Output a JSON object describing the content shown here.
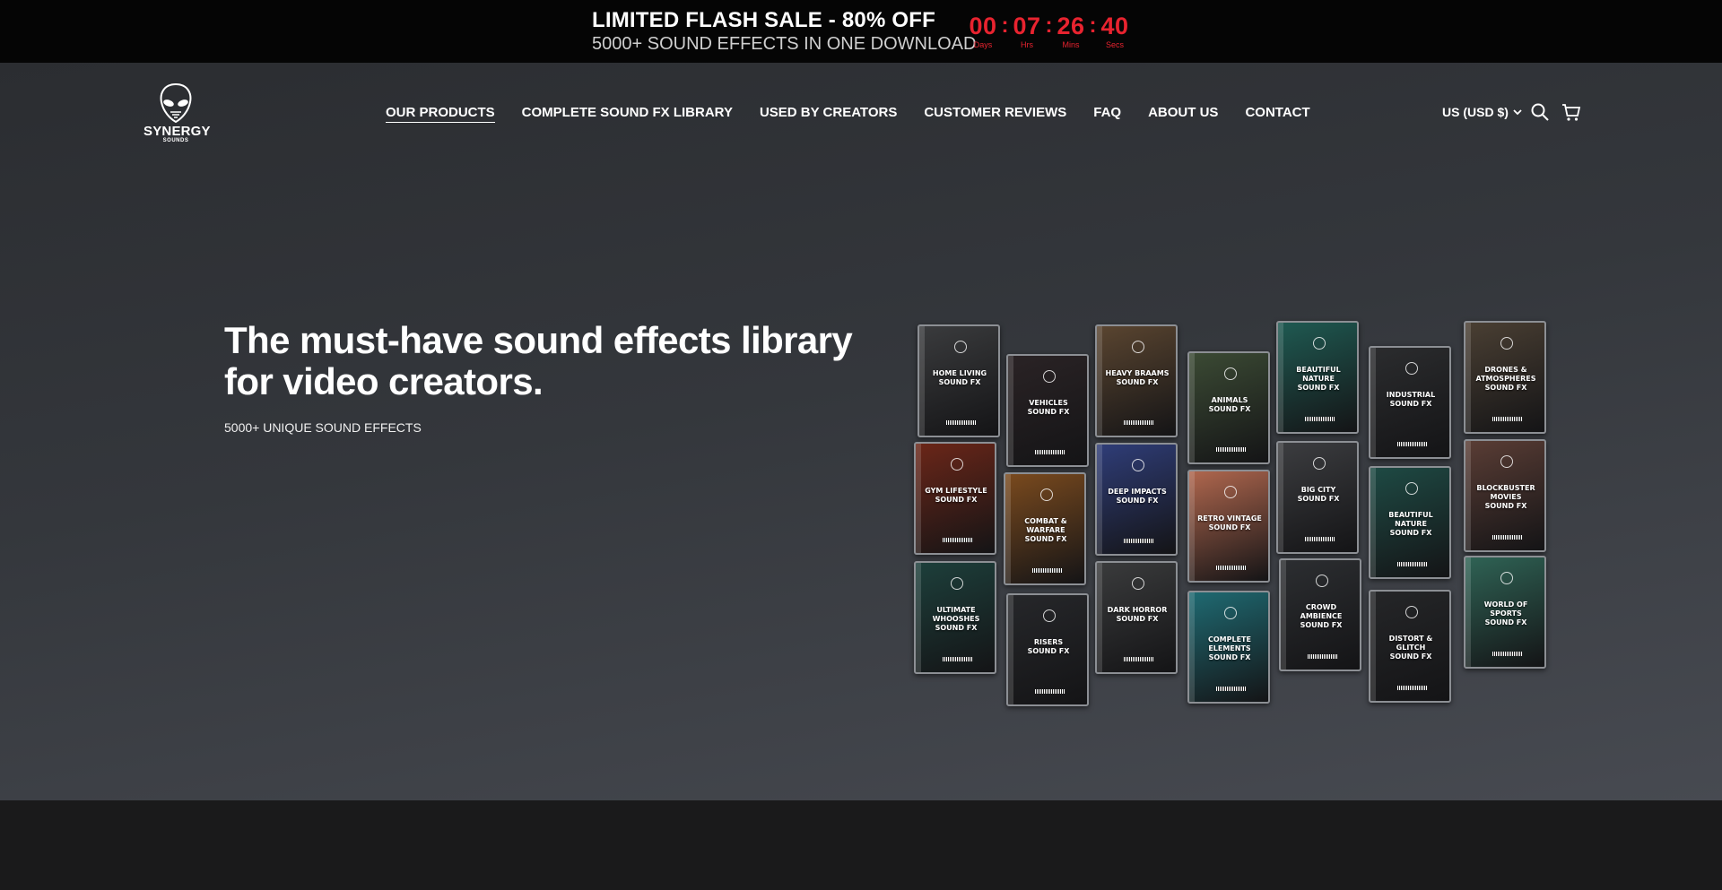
{
  "announcement": {
    "title": "LIMITED FLASH SALE - 80% OFF",
    "subtitle": "5000+ SOUND EFFECTS IN ONE DOWNLOAD",
    "countdown": [
      {
        "value": "00",
        "label": "Days"
      },
      {
        "value": "07",
        "label": "Hrs"
      },
      {
        "value": "26",
        "label": "Mins"
      },
      {
        "value": "40",
        "label": "Secs"
      }
    ],
    "separator": ":",
    "accent_color": "#e8232f"
  },
  "header": {
    "logo": {
      "name": "SYNERGY",
      "sub": "SOUNDS",
      "icon": "alien-head-icon"
    },
    "nav": [
      {
        "label": "OUR PRODUCTS",
        "active": true
      },
      {
        "label": "COMPLETE SOUND FX LIBRARY"
      },
      {
        "label": "USED BY CREATORS"
      },
      {
        "label": "CUSTOMER REVIEWS"
      },
      {
        "label": "FAQ"
      },
      {
        "label": "ABOUT US"
      },
      {
        "label": "CONTACT"
      }
    ],
    "currency": "US (USD $)",
    "icons": [
      "chevron-down-icon",
      "search-icon",
      "cart-icon"
    ]
  },
  "hero": {
    "title_line1": "The must-have sound effects library",
    "title_line2": "for video creators.",
    "subtitle": "5000+ UNIQUE SOUND EFFECTS"
  },
  "packs": [
    {
      "line1": "HOME LIVING",
      "line2": "SOUND FX",
      "color": "#3a3b3d"
    },
    {
      "line1": "VEHICLES",
      "line2": "SOUND FX",
      "color": "#2a2325"
    },
    {
      "line1": "HEAVY BRAAMS",
      "line2": "SOUND FX",
      "color": "#5a4530"
    },
    {
      "line1": "ANIMALS",
      "line2": "SOUND FX",
      "color": "#3b4a34"
    },
    {
      "line1": "BEAUTIFUL NATURE",
      "line2": "SOUND FX",
      "color": "#1f5a52"
    },
    {
      "line1": "INDUSTRIAL",
      "line2": "SOUND FX",
      "color": "#2b2c2e"
    },
    {
      "line1": "DRONES & ATMOSPHERES",
      "line2": "SOUND FX",
      "color": "#4a3f33"
    },
    {
      "line1": "GYM LIFESTYLE",
      "line2": "SOUND FX",
      "color": "#6b2618"
    },
    {
      "line1": "COMBAT & WARFARE",
      "line2": "SOUND FX",
      "color": "#7a4a1e"
    },
    {
      "line1": "DEEP IMPACTS",
      "line2": "SOUND FX",
      "color": "#2f3d78"
    },
    {
      "line1": "RETRO VINTAGE",
      "line2": "SOUND FX",
      "color": "#b0674e"
    },
    {
      "line1": "BIG CITY",
      "line2": "SOUND FX",
      "color": "#3c3d40"
    },
    {
      "line1": "BEAUTIFUL NATURE",
      "line2": "SOUND FX",
      "color": "#1e4a44"
    },
    {
      "line1": "BLOCKBUSTER MOVIES",
      "line2": "SOUND FX",
      "color": "#5a3d35"
    },
    {
      "line1": "ULTIMATE WHOOSHES",
      "line2": "SOUND FX",
      "color": "#1d3f3b"
    },
    {
      "line1": "RISERS",
      "line2": "SOUND FX",
      "color": "#26272a"
    },
    {
      "line1": "DARK HORROR",
      "line2": "SOUND FX",
      "color": "#3a3b3c"
    },
    {
      "line1": "COMPLETE ELEMENTS",
      "line2": "SOUND FX",
      "color": "#1f6a72"
    },
    {
      "line1": "CROWD AMBIENCE",
      "line2": "SOUND FX",
      "color": "#2c2e31"
    },
    {
      "line1": "DISTORT & GLITCH",
      "line2": "SOUND FX",
      "color": "#252628"
    },
    {
      "line1": "WORLD OF SPORTS",
      "line2": "SOUND FX",
      "color": "#2f6355"
    }
  ]
}
